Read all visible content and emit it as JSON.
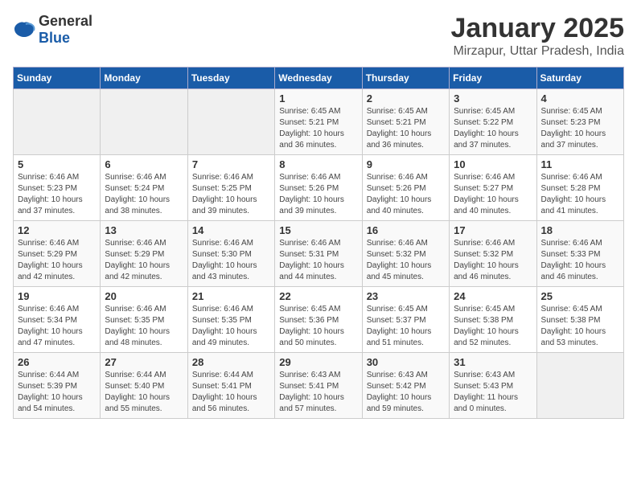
{
  "logo": {
    "general": "General",
    "blue": "Blue"
  },
  "title": "January 2025",
  "subtitle": "Mirzapur, Uttar Pradesh, India",
  "days_of_week": [
    "Sunday",
    "Monday",
    "Tuesday",
    "Wednesday",
    "Thursday",
    "Friday",
    "Saturday"
  ],
  "weeks": [
    [
      {
        "day": "",
        "info": ""
      },
      {
        "day": "",
        "info": ""
      },
      {
        "day": "",
        "info": ""
      },
      {
        "day": "1",
        "info": "Sunrise: 6:45 AM\nSunset: 5:21 PM\nDaylight: 10 hours and 36 minutes."
      },
      {
        "day": "2",
        "info": "Sunrise: 6:45 AM\nSunset: 5:21 PM\nDaylight: 10 hours and 36 minutes."
      },
      {
        "day": "3",
        "info": "Sunrise: 6:45 AM\nSunset: 5:22 PM\nDaylight: 10 hours and 37 minutes."
      },
      {
        "day": "4",
        "info": "Sunrise: 6:45 AM\nSunset: 5:23 PM\nDaylight: 10 hours and 37 minutes."
      }
    ],
    [
      {
        "day": "5",
        "info": "Sunrise: 6:46 AM\nSunset: 5:23 PM\nDaylight: 10 hours and 37 minutes."
      },
      {
        "day": "6",
        "info": "Sunrise: 6:46 AM\nSunset: 5:24 PM\nDaylight: 10 hours and 38 minutes."
      },
      {
        "day": "7",
        "info": "Sunrise: 6:46 AM\nSunset: 5:25 PM\nDaylight: 10 hours and 39 minutes."
      },
      {
        "day": "8",
        "info": "Sunrise: 6:46 AM\nSunset: 5:26 PM\nDaylight: 10 hours and 39 minutes."
      },
      {
        "day": "9",
        "info": "Sunrise: 6:46 AM\nSunset: 5:26 PM\nDaylight: 10 hours and 40 minutes."
      },
      {
        "day": "10",
        "info": "Sunrise: 6:46 AM\nSunset: 5:27 PM\nDaylight: 10 hours and 40 minutes."
      },
      {
        "day": "11",
        "info": "Sunrise: 6:46 AM\nSunset: 5:28 PM\nDaylight: 10 hours and 41 minutes."
      }
    ],
    [
      {
        "day": "12",
        "info": "Sunrise: 6:46 AM\nSunset: 5:29 PM\nDaylight: 10 hours and 42 minutes."
      },
      {
        "day": "13",
        "info": "Sunrise: 6:46 AM\nSunset: 5:29 PM\nDaylight: 10 hours and 42 minutes."
      },
      {
        "day": "14",
        "info": "Sunrise: 6:46 AM\nSunset: 5:30 PM\nDaylight: 10 hours and 43 minutes."
      },
      {
        "day": "15",
        "info": "Sunrise: 6:46 AM\nSunset: 5:31 PM\nDaylight: 10 hours and 44 minutes."
      },
      {
        "day": "16",
        "info": "Sunrise: 6:46 AM\nSunset: 5:32 PM\nDaylight: 10 hours and 45 minutes."
      },
      {
        "day": "17",
        "info": "Sunrise: 6:46 AM\nSunset: 5:32 PM\nDaylight: 10 hours and 46 minutes."
      },
      {
        "day": "18",
        "info": "Sunrise: 6:46 AM\nSunset: 5:33 PM\nDaylight: 10 hours and 46 minutes."
      }
    ],
    [
      {
        "day": "19",
        "info": "Sunrise: 6:46 AM\nSunset: 5:34 PM\nDaylight: 10 hours and 47 minutes."
      },
      {
        "day": "20",
        "info": "Sunrise: 6:46 AM\nSunset: 5:35 PM\nDaylight: 10 hours and 48 minutes."
      },
      {
        "day": "21",
        "info": "Sunrise: 6:46 AM\nSunset: 5:35 PM\nDaylight: 10 hours and 49 minutes."
      },
      {
        "day": "22",
        "info": "Sunrise: 6:45 AM\nSunset: 5:36 PM\nDaylight: 10 hours and 50 minutes."
      },
      {
        "day": "23",
        "info": "Sunrise: 6:45 AM\nSunset: 5:37 PM\nDaylight: 10 hours and 51 minutes."
      },
      {
        "day": "24",
        "info": "Sunrise: 6:45 AM\nSunset: 5:38 PM\nDaylight: 10 hours and 52 minutes."
      },
      {
        "day": "25",
        "info": "Sunrise: 6:45 AM\nSunset: 5:38 PM\nDaylight: 10 hours and 53 minutes."
      }
    ],
    [
      {
        "day": "26",
        "info": "Sunrise: 6:44 AM\nSunset: 5:39 PM\nDaylight: 10 hours and 54 minutes."
      },
      {
        "day": "27",
        "info": "Sunrise: 6:44 AM\nSunset: 5:40 PM\nDaylight: 10 hours and 55 minutes."
      },
      {
        "day": "28",
        "info": "Sunrise: 6:44 AM\nSunset: 5:41 PM\nDaylight: 10 hours and 56 minutes."
      },
      {
        "day": "29",
        "info": "Sunrise: 6:43 AM\nSunset: 5:41 PM\nDaylight: 10 hours and 57 minutes."
      },
      {
        "day": "30",
        "info": "Sunrise: 6:43 AM\nSunset: 5:42 PM\nDaylight: 10 hours and 59 minutes."
      },
      {
        "day": "31",
        "info": "Sunrise: 6:43 AM\nSunset: 5:43 PM\nDaylight: 11 hours and 0 minutes."
      },
      {
        "day": "",
        "info": ""
      }
    ]
  ]
}
